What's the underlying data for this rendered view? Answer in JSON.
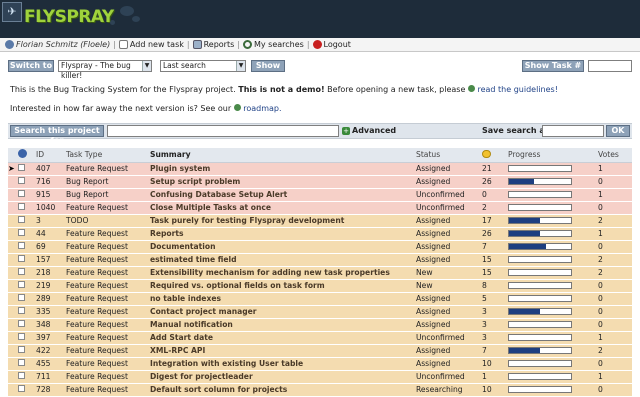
{
  "brand": {
    "name": "FLYSPRAY"
  },
  "userbar": {
    "user": "Florian Schmitz (Floele)",
    "add_task": "Add new task",
    "reports": "Reports",
    "my_searches": "My searches",
    "logout": "Logout"
  },
  "toolbar": {
    "switch_label": "Switch to",
    "project_select": "Flyspray - The bug killer!",
    "search_select": "Last search",
    "show_label": "Show",
    "show_task_label": "Show Task #"
  },
  "intro": {
    "line1_pre": "This is the Bug Tracking System for the Flyspray project. ",
    "line1_bold": "This is not a demo!",
    "line1_post": " Before opening a new task, please ",
    "line1_link": "read the guidelines!",
    "line2_pre": "Interested in how far away the next version is? See our ",
    "line2_link": "roadmap."
  },
  "search": {
    "button_label": "Search this project for",
    "advanced_label": "Advanced",
    "save_label": "Save search as",
    "ok_label": "OK"
  },
  "table": {
    "columns": {
      "id": "ID",
      "type": "Task Type",
      "summary": "Summary",
      "status": "Status",
      "progress": "Progress",
      "votes": "Votes"
    },
    "rows": [
      {
        "id": "407",
        "type": "Feature Request",
        "summary": "Plugin system",
        "status": "Assigned",
        "comments": "21",
        "progress": 0,
        "votes": "1",
        "tone": "red",
        "current": true
      },
      {
        "id": "716",
        "type": "Bug Report",
        "summary": "Setup script problem",
        "status": "Assigned",
        "comments": "26",
        "progress": 40,
        "votes": "0",
        "tone": "red"
      },
      {
        "id": "915",
        "type": "Bug Report",
        "summary": "Confusing Database Setup Alert",
        "status": "Unconfirmed",
        "comments": "0",
        "progress": 0,
        "votes": "1",
        "tone": "red"
      },
      {
        "id": "1040",
        "type": "Feature Request",
        "summary": "Close Multiple Tasks at once",
        "status": "Unconfirmed",
        "comments": "2",
        "progress": 0,
        "votes": "0",
        "tone": "red"
      },
      {
        "id": "3",
        "type": "TODO",
        "summary": "Task purely for testing Flyspray development",
        "status": "Assigned",
        "comments": "17",
        "progress": 50,
        "votes": "2",
        "tone": "yel"
      },
      {
        "id": "44",
        "type": "Feature Request",
        "summary": "Reports",
        "status": "Assigned",
        "comments": "26",
        "progress": 50,
        "votes": "1",
        "tone": "yel"
      },
      {
        "id": "69",
        "type": "Feature Request",
        "summary": "Documentation",
        "status": "Assigned",
        "comments": "7",
        "progress": 60,
        "votes": "0",
        "tone": "yel"
      },
      {
        "id": "157",
        "type": "Feature Request",
        "summary": "estimated time field",
        "status": "Assigned",
        "comments": "15",
        "progress": 0,
        "votes": "2",
        "tone": "yel"
      },
      {
        "id": "218",
        "type": "Feature Request",
        "summary": "Extensibility mechanism for adding new task properties",
        "status": "New",
        "comments": "15",
        "progress": 0,
        "votes": "2",
        "tone": "yel"
      },
      {
        "id": "219",
        "type": "Feature Request",
        "summary": "Required vs. optional fields on task form",
        "status": "New",
        "comments": "8",
        "progress": 0,
        "votes": "0",
        "tone": "yel"
      },
      {
        "id": "289",
        "type": "Feature Request",
        "summary": "no table indexes",
        "status": "Assigned",
        "comments": "5",
        "progress": 0,
        "votes": "0",
        "tone": "yel"
      },
      {
        "id": "335",
        "type": "Feature Request",
        "summary": "Contact project manager",
        "status": "Assigned",
        "comments": "3",
        "progress": 50,
        "votes": "0",
        "tone": "yel"
      },
      {
        "id": "348",
        "type": "Feature Request",
        "summary": "Manual notification",
        "status": "Assigned",
        "comments": "3",
        "progress": 0,
        "votes": "0",
        "tone": "yel"
      },
      {
        "id": "397",
        "type": "Feature Request",
        "summary": "Add Start date",
        "status": "Unconfirmed",
        "comments": "3",
        "progress": 0,
        "votes": "1",
        "tone": "yel"
      },
      {
        "id": "422",
        "type": "Feature Request",
        "summary": "XML-RPC API",
        "status": "Assigned",
        "comments": "7",
        "progress": 50,
        "votes": "2",
        "tone": "yel"
      },
      {
        "id": "455",
        "type": "Feature Request",
        "summary": "Integration with existing User table",
        "status": "Assigned",
        "comments": "10",
        "progress": 0,
        "votes": "0",
        "tone": "yel"
      },
      {
        "id": "711",
        "type": "Feature Request",
        "summary": "Digest for projectleader",
        "status": "Unconfirmed",
        "comments": "1",
        "progress": 0,
        "votes": "1",
        "tone": "yel"
      },
      {
        "id": "728",
        "type": "Feature Request",
        "summary": "Default sort column for projects",
        "status": "Researching",
        "comments": "10",
        "progress": 0,
        "votes": "0",
        "tone": "yel"
      }
    ]
  }
}
